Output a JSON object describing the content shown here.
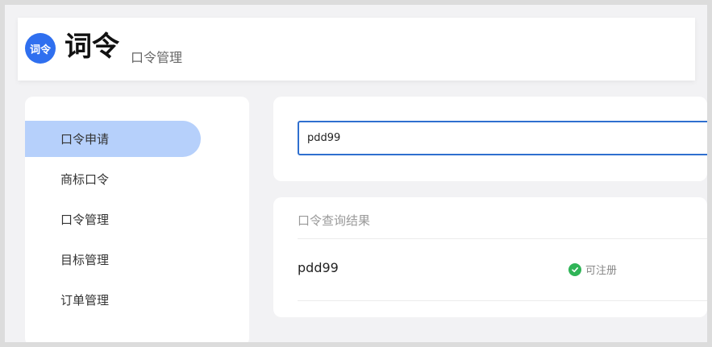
{
  "brand": {
    "logo_text": "词令",
    "name": "词令",
    "subtitle": "口令管理"
  },
  "sidebar": {
    "items": [
      {
        "label": "口令申请",
        "active": true
      },
      {
        "label": "商标口令",
        "active": false
      },
      {
        "label": "口令管理",
        "active": false
      },
      {
        "label": "目标管理",
        "active": false
      },
      {
        "label": "订单管理",
        "active": false
      }
    ]
  },
  "search": {
    "value": "pdd99"
  },
  "results": {
    "title": "口令查询结果",
    "rows": [
      {
        "name": "pdd99",
        "status": "可注册"
      }
    ]
  },
  "colors": {
    "accent": "#2f6fef",
    "active_nav_bg": "#b6d0fb",
    "status_ok": "#2fb457"
  },
  "icons": {
    "status": "check-circle-icon"
  }
}
